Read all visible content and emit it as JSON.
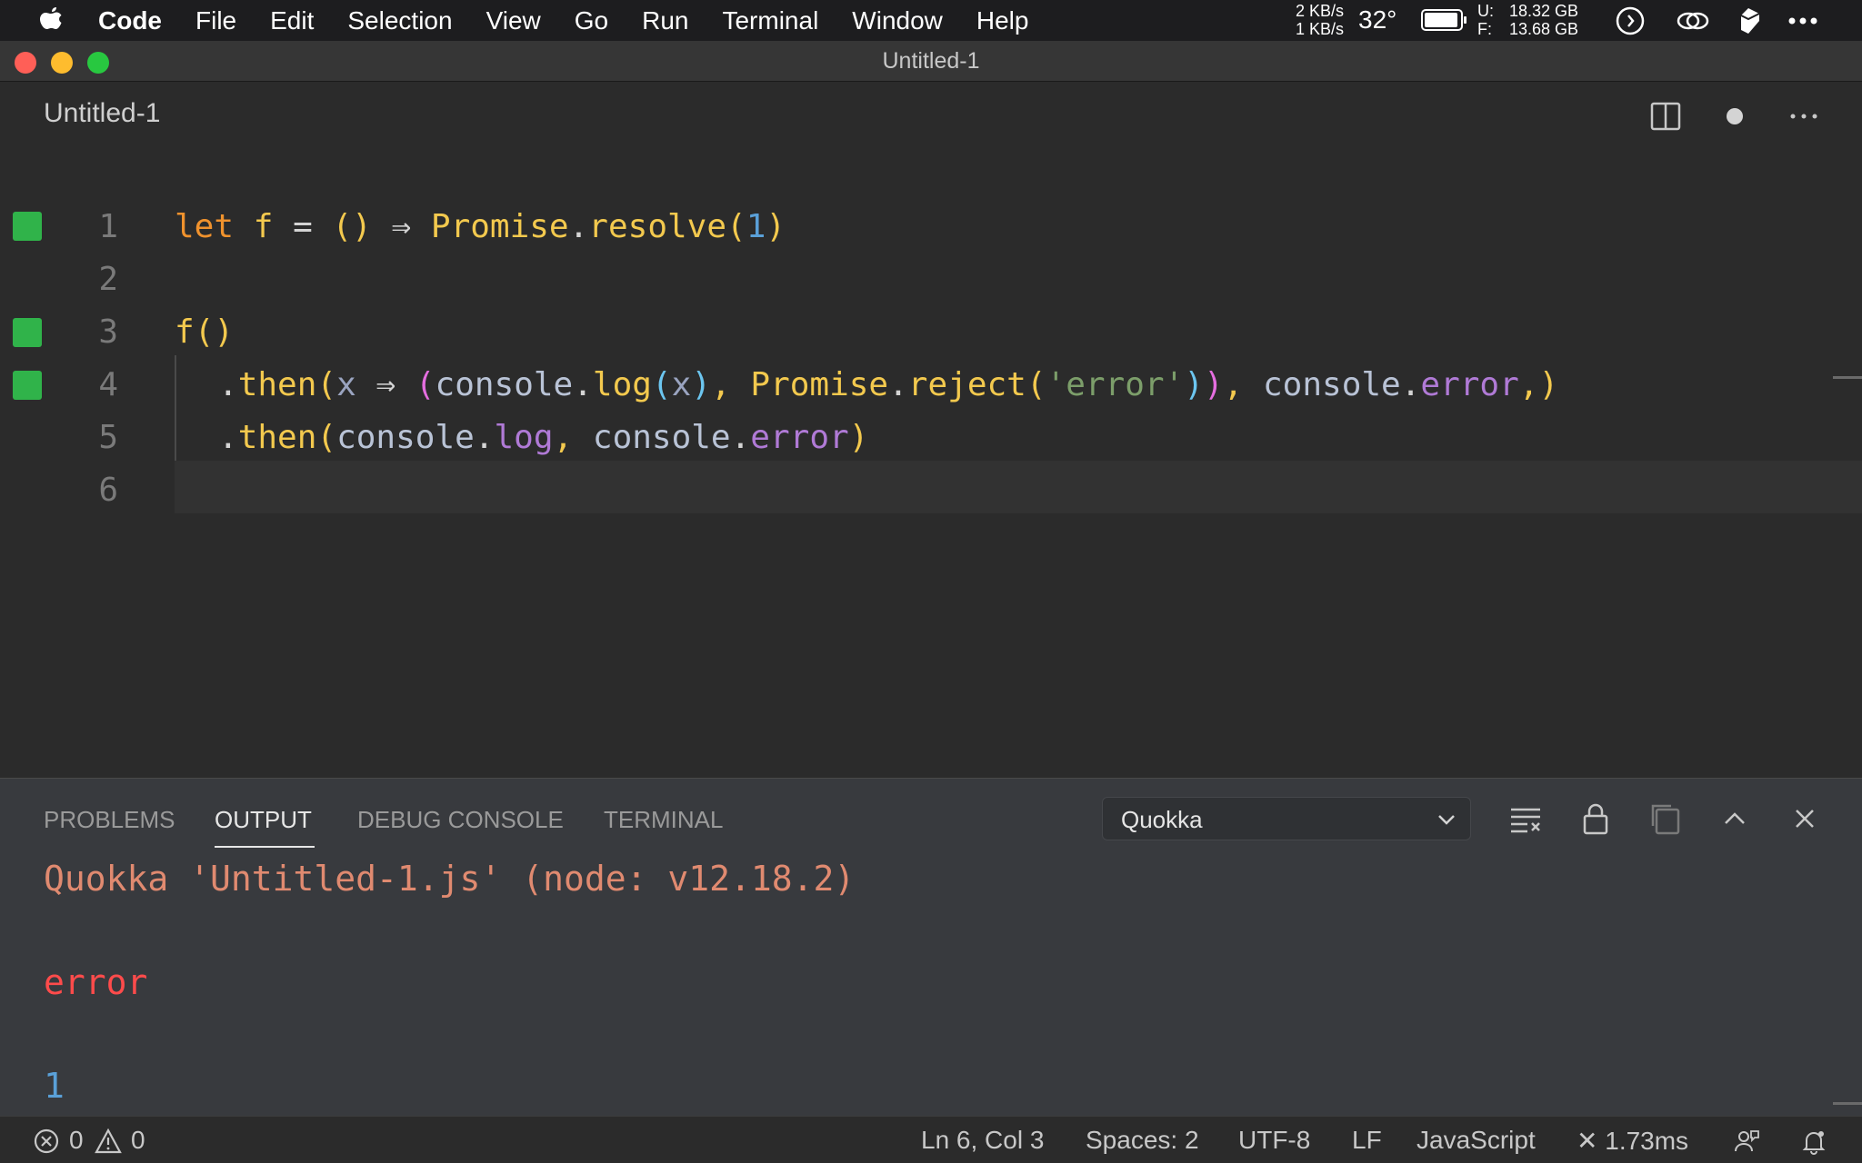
{
  "menubar": {
    "app": "Code",
    "menus": [
      "File",
      "Edit",
      "Selection",
      "View",
      "Go",
      "Run",
      "Terminal",
      "Window",
      "Help"
    ],
    "net_up": "2 KB/s",
    "net_down": "1 KB/s",
    "temperature": "32°",
    "disk_u_label": "U:",
    "disk_f_label": "F:",
    "disk_u_value": "18.32 GB",
    "disk_f_value": "13.68 GB",
    "icons": [
      "apple-icon",
      "battery-icon",
      "clock-icon",
      "link-icon",
      "cube-icon",
      "more-icon"
    ]
  },
  "window": {
    "title": "Untitled-1",
    "tab_title": "Untitled-1"
  },
  "editor": {
    "line_numbers": [
      "1",
      "2",
      "3",
      "4",
      "5",
      "6"
    ],
    "lines": {
      "l1": {
        "let": "let",
        "f": "f",
        "eq": "=",
        "parens": "()",
        "arrow": "⇒",
        "promise": "Promise",
        "dot": ".",
        "resolve": "resolve",
        "lp": "(",
        "one": "1",
        "rp": ")"
      },
      "l3": {
        "f": "f",
        "parens": "()"
      },
      "l4": {
        "dot": ".",
        "then": "then",
        "lp": "(",
        "x": "x",
        "arrow": "⇒",
        "lp2": "(",
        "console": "console",
        "dot2": ".",
        "log": "log",
        "lp3": "(",
        "x2": "x",
        "rp3": ")",
        "comma": ",",
        "promise": "Promise",
        "dot3": ".",
        "reject": "reject",
        "lp4": "(",
        "str": "'error'",
        "rp4": ")",
        "rp2": ")",
        "comma2": ",",
        "console2": "console",
        "dot4": ".",
        "error": "error",
        "comma3": ",",
        "rp": ")"
      },
      "l5": {
        "dot": ".",
        "then": "then",
        "lp": "(",
        "console": "console",
        "dot2": ".",
        "log": "log",
        "comma": ",",
        "console2": "console",
        "dot3": ".",
        "error": "error",
        "rp": ")"
      }
    }
  },
  "panel": {
    "tabs": [
      "PROBLEMS",
      "OUTPUT",
      "DEBUG CONSOLE",
      "TERMINAL"
    ],
    "active_tab": "OUTPUT",
    "channel": "Quokka",
    "output": [
      "Quokka 'Untitled-1.js' (node: v12.18.2)",
      "error",
      "1"
    ]
  },
  "statusbar": {
    "errors": "0",
    "warnings": "0",
    "position": "Ln 6, Col 3",
    "spaces": "Spaces: 2",
    "encoding": "UTF-8",
    "eol": "LF",
    "language": "JavaScript",
    "quokka_time": "✕ 1.73ms"
  }
}
